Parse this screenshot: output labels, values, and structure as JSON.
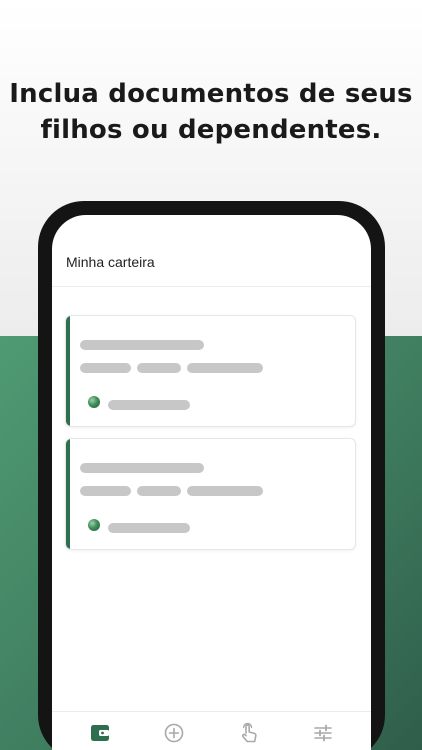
{
  "headline": {
    "line1": "Inclua documentos de seus",
    "line2": "filhos ou dependentes."
  },
  "app": {
    "title": "Minha carteira"
  },
  "cards": [
    {
      "state": "loading-placeholder",
      "icon": "globe-icon"
    },
    {
      "state": "loading-placeholder",
      "icon": "globe-icon"
    }
  ],
  "bottom_nav": {
    "items": [
      {
        "icon": "wallet-icon",
        "active": true
      },
      {
        "icon": "add-circle-icon",
        "active": false
      },
      {
        "icon": "touch-icon",
        "active": false
      },
      {
        "icon": "sliders-icon",
        "active": false
      }
    ]
  },
  "colors": {
    "accent_green": "#2f6e4e",
    "background_green": "#4f9a73",
    "placeholder_gray": "#c7c7c7",
    "phone_frame": "#141414"
  }
}
